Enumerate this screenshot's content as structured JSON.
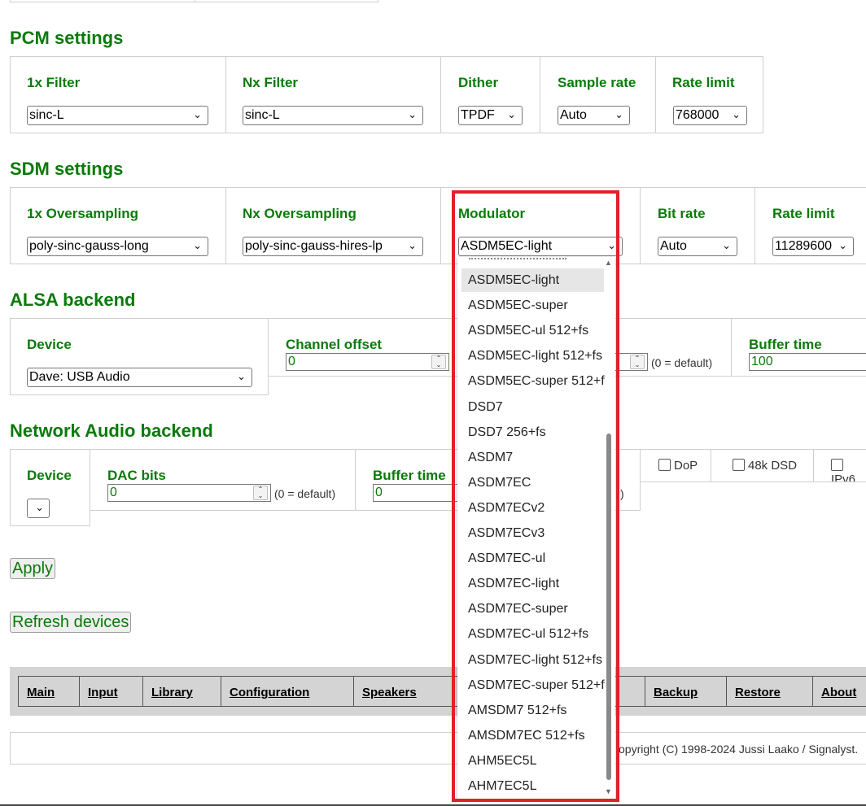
{
  "pcm": {
    "title": "PCM settings",
    "filter1x": {
      "label": "1x Filter",
      "value": "sinc-L"
    },
    "filterNx": {
      "label": "Nx Filter",
      "value": "sinc-L"
    },
    "dither": {
      "label": "Dither",
      "value": "TPDF"
    },
    "sample_rate": {
      "label": "Sample rate",
      "value": "Auto"
    },
    "rate_limit": {
      "label": "Rate limit",
      "value": "768000"
    }
  },
  "sdm": {
    "title": "SDM settings",
    "os1x": {
      "label": "1x Oversampling",
      "value": "poly-sinc-gauss-long"
    },
    "osNx": {
      "label": "Nx Oversampling",
      "value": "poly-sinc-gauss-hires-lp"
    },
    "modulator": {
      "label": "Modulator",
      "value": "ASDM5EC-light"
    },
    "bit_rate": {
      "label": "Bit rate",
      "value": "Auto"
    },
    "rate_limit": {
      "label": "Rate limit",
      "value": "11289600"
    }
  },
  "alsa": {
    "title": "ALSA backend",
    "device": {
      "label": "Device",
      "value": "Dave: USB Audio"
    },
    "channel_offset": {
      "label": "Channel offset",
      "value": "0"
    },
    "hint": "(0 = default)",
    "buffer_time": {
      "label": "Buffer time",
      "value": "100"
    }
  },
  "net": {
    "title": "Network Audio backend",
    "device": {
      "label": "Device"
    },
    "dac_bits": {
      "label": "DAC bits",
      "value": "0",
      "hint": "(0 = default)"
    },
    "buffer_time": {
      "label": "Buffer time",
      "value": "0"
    },
    "hint_fragment": ")",
    "checks": [
      "DoP",
      "48k DSD",
      "IPv6"
    ]
  },
  "buttons": {
    "apply": "Apply",
    "refresh": "Refresh devices"
  },
  "nav": [
    "Main",
    "Input",
    "Library",
    "Configuration",
    "Speakers",
    "Backup",
    "Restore",
    "About"
  ],
  "footer": "opyright (C) 1998-2024 Jussi Laako / Signalyst.",
  "dropdown": {
    "highlighted": "ASDM5EC-light",
    "options": [
      "ASDM5EC-light",
      "ASDM5EC-super",
      "ASDM5EC-ul 512+fs",
      "ASDM5EC-light 512+fs",
      "ASDM5EC-super 512+f",
      "DSD7",
      "DSD7 256+fs",
      "ASDM7",
      "ASDM7EC",
      "ASDM7ECv2",
      "ASDM7ECv3",
      "ASDM7EC-ul",
      "ASDM7EC-light",
      "ASDM7EC-super",
      "ASDM7EC-ul 512+fs",
      "ASDM7EC-light 512+fs",
      "ASDM7EC-super 512+f",
      "AMSDM7 512+fs",
      "AMSDM7EC 512+fs",
      "AHM5EC5L",
      "AHM7EC5L"
    ]
  },
  "colors": {
    "accent": "#0a7a0a",
    "highlight_frame": "#e0202a"
  }
}
